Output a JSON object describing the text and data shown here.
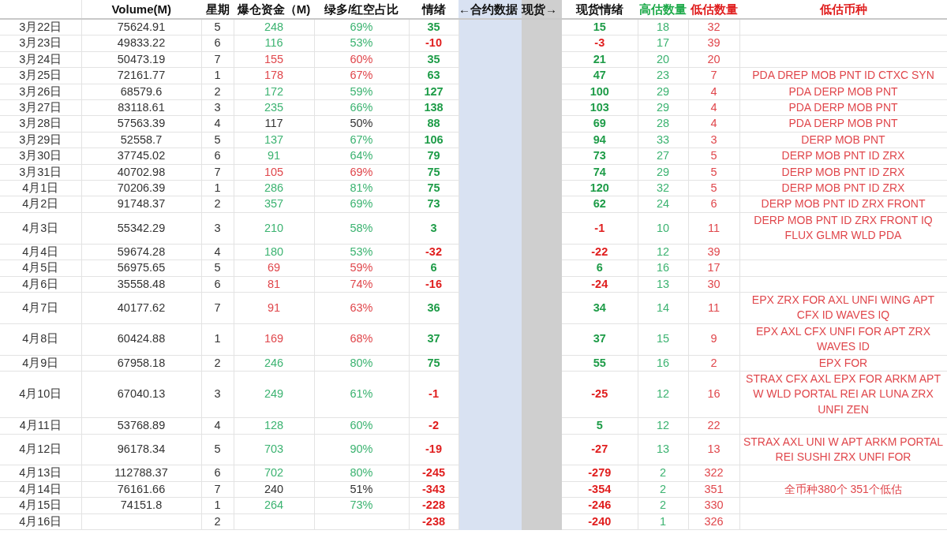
{
  "headers": [
    {
      "label": "Volume(M)"
    },
    {
      "label": "星期"
    },
    {
      "label": "爆仓资金（M)"
    },
    {
      "label": "绿多/红空占比"
    },
    {
      "label": "情绪"
    },
    {
      "label": "←合约数据"
    },
    {
      "label": "现货→"
    },
    {
      "label": "现货情绪"
    },
    {
      "label": "高估数量",
      "color": "#1eaa4a"
    },
    {
      "label": "低估数量",
      "color": "#e01e1e"
    },
    {
      "label": "低估币种",
      "color": "#e01e1e"
    }
  ],
  "rows": [
    {
      "date": "3月22日",
      "volume": "75624.91",
      "weekday": "5",
      "liquidation": {
        "text": "248",
        "color": "#3cb371"
      },
      "ratio": {
        "text": "69%",
        "color": "#3cb371"
      },
      "sentiment": {
        "text": "35",
        "color": "#1e9c48"
      },
      "spot": {
        "text": "15",
        "color": "#1e9c48"
      },
      "high": "18",
      "low": "32"
    },
    {
      "date": "3月23日",
      "volume": "49833.22",
      "weekday": "6",
      "liquidation": {
        "text": "116",
        "color": "#3cb371"
      },
      "ratio": {
        "text": "53%",
        "color": "#3cb371"
      },
      "sentiment": {
        "text": "-10",
        "color": "#e01e1e"
      },
      "spot": {
        "text": "-3",
        "color": "#e01e1e"
      },
      "high": "17",
      "low": "39"
    },
    {
      "date": "3月24日",
      "volume": "50473.19",
      "weekday": "7",
      "liquidation": {
        "text": "155",
        "color": "#e0474c"
      },
      "ratio": {
        "text": "60%",
        "color": "#e0474c"
      },
      "sentiment": {
        "text": "35",
        "color": "#1e9c48"
      },
      "spot": {
        "text": "21",
        "color": "#1e9c48"
      },
      "high": "20",
      "low": "20"
    },
    {
      "date": "3月25日",
      "volume": "72161.77",
      "weekday": "1",
      "liquidation": {
        "text": "178",
        "color": "#e0474c"
      },
      "ratio": {
        "text": "67%",
        "color": "#e0474c"
      },
      "sentiment": {
        "text": "63",
        "color": "#1e9c48"
      },
      "spot": {
        "text": "47",
        "color": "#1e9c48"
      },
      "high": "23",
      "low": "7",
      "coins": "PDA DREP MOB PNT ID CTXC SYN"
    },
    {
      "date": "3月26日",
      "volume": "68579.6",
      "weekday": "2",
      "liquidation": {
        "text": "172",
        "color": "#3cb371"
      },
      "ratio": {
        "text": "59%",
        "color": "#3cb371"
      },
      "sentiment": {
        "text": "127",
        "color": "#1e9c48"
      },
      "spot": {
        "text": "100",
        "color": "#1e9c48"
      },
      "high": "29",
      "low": "4",
      "coins": "PDA DERP MOB PNT"
    },
    {
      "date": "3月27日",
      "volume": "83118.61",
      "weekday": "3",
      "liquidation": {
        "text": "235",
        "color": "#3cb371"
      },
      "ratio": {
        "text": "66%",
        "color": "#3cb371"
      },
      "sentiment": {
        "text": "138",
        "color": "#1e9c48"
      },
      "spot": {
        "text": "103",
        "color": "#1e9c48"
      },
      "high": "29",
      "low": "4",
      "coins": "PDA DERP MOB PNT"
    },
    {
      "date": "3月28日",
      "volume": "57563.39",
      "weekday": "4",
      "liquidation": {
        "text": "117",
        "color": "#333333"
      },
      "ratio": {
        "text": "50%",
        "color": "#333333"
      },
      "sentiment": {
        "text": "88",
        "color": "#1e9c48"
      },
      "spot": {
        "text": "69",
        "color": "#1e9c48"
      },
      "high": "28",
      "low": "4",
      "coins": "PDA DERP MOB PNT"
    },
    {
      "date": "3月29日",
      "volume": "52558.7",
      "weekday": "5",
      "liquidation": {
        "text": "137",
        "color": "#3cb371"
      },
      "ratio": {
        "text": "67%",
        "color": "#3cb371"
      },
      "sentiment": {
        "text": "106",
        "color": "#1e9c48"
      },
      "spot": {
        "text": "94",
        "color": "#1e9c48"
      },
      "high": "33",
      "low": "3",
      "coins": "DERP MOB PNT"
    },
    {
      "date": "3月30日",
      "volume": "37745.02",
      "weekday": "6",
      "liquidation": {
        "text": "91",
        "color": "#3cb371"
      },
      "ratio": {
        "text": "64%",
        "color": "#3cb371"
      },
      "sentiment": {
        "text": "79",
        "color": "#1e9c48"
      },
      "spot": {
        "text": "73",
        "color": "#1e9c48"
      },
      "high": "27",
      "low": "5",
      "coins": "DERP MOB PNT ID ZRX"
    },
    {
      "date": "3月31日",
      "volume": "40702.98",
      "weekday": "7",
      "liquidation": {
        "text": "105",
        "color": "#e0474c"
      },
      "ratio": {
        "text": "69%",
        "color": "#e0474c"
      },
      "sentiment": {
        "text": "75",
        "color": "#1e9c48"
      },
      "spot": {
        "text": "74",
        "color": "#1e9c48"
      },
      "high": "29",
      "low": "5",
      "coins": "DERP MOB PNT ID ZRX"
    },
    {
      "date": "4月1日",
      "volume": "70206.39",
      "weekday": "1",
      "liquidation": {
        "text": "286",
        "color": "#3cb371"
      },
      "ratio": {
        "text": "81%",
        "color": "#3cb371"
      },
      "sentiment": {
        "text": "75",
        "color": "#1e9c48"
      },
      "spot": {
        "text": "120",
        "color": "#1e9c48"
      },
      "high": "32",
      "low": "5",
      "coins": "DERP MOB PNT ID ZRX"
    },
    {
      "date": "4月2日",
      "volume": "91748.37",
      "weekday": "2",
      "liquidation": {
        "text": "357",
        "color": "#3cb371"
      },
      "ratio": {
        "text": "69%",
        "color": "#3cb371"
      },
      "sentiment": {
        "text": "73",
        "color": "#1e9c48"
      },
      "spot": {
        "text": "62",
        "color": "#1e9c48"
      },
      "high": "24",
      "low": "6",
      "coins": "DERP MOB PNT ID ZRX FRONT"
    },
    {
      "date": "4月3日",
      "volume": "55342.29",
      "weekday": "3",
      "liquidation": {
        "text": "210",
        "color": "#3cb371"
      },
      "ratio": {
        "text": "58%",
        "color": "#3cb371"
      },
      "sentiment": {
        "text": "3",
        "color": "#1e9c48"
      },
      "spot": {
        "text": "-1",
        "color": "#e01e1e"
      },
      "high": "10",
      "low": "11",
      "coins": "DERP MOB PNT ID ZRX FRONT IQ FLUX GLMR WLD PDA"
    },
    {
      "date": "4月4日",
      "volume": "59674.28",
      "weekday": "4",
      "liquidation": {
        "text": "180",
        "color": "#3cb371"
      },
      "ratio": {
        "text": "53%",
        "color": "#3cb371"
      },
      "sentiment": {
        "text": "-32",
        "color": "#e01e1e"
      },
      "spot": {
        "text": "-22",
        "color": "#e01e1e"
      },
      "high": "12",
      "low": "39"
    },
    {
      "date": "4月5日",
      "volume": "56975.65",
      "weekday": "5",
      "liquidation": {
        "text": "69",
        "color": "#e0474c"
      },
      "ratio": {
        "text": "59%",
        "color": "#e0474c"
      },
      "sentiment": {
        "text": "6",
        "color": "#1e9c48"
      },
      "spot": {
        "text": "6",
        "color": "#1e9c48"
      },
      "high": "16",
      "low": "17"
    },
    {
      "date": "4月6日",
      "volume": "35558.48",
      "weekday": "6",
      "liquidation": {
        "text": "81",
        "color": "#e0474c"
      },
      "ratio": {
        "text": "74%",
        "color": "#e0474c"
      },
      "sentiment": {
        "text": "-16",
        "color": "#e01e1e"
      },
      "spot": {
        "text": "-24",
        "color": "#e01e1e"
      },
      "high": "13",
      "low": "30"
    },
    {
      "date": "4月7日",
      "volume": "40177.62",
      "weekday": "7",
      "liquidation": {
        "text": "91",
        "color": "#e0474c"
      },
      "ratio": {
        "text": "63%",
        "color": "#e0474c"
      },
      "sentiment": {
        "text": "36",
        "color": "#1e9c48"
      },
      "spot": {
        "text": "34",
        "color": "#1e9c48"
      },
      "high": "14",
      "low": "11",
      "coins": "EPX ZRX FOR AXL UNFI WING APT CFX ID WAVES IQ"
    },
    {
      "date": "4月8日",
      "volume": "60424.88",
      "weekday": "1",
      "liquidation": {
        "text": "169",
        "color": "#e0474c"
      },
      "ratio": {
        "text": "68%",
        "color": "#e0474c"
      },
      "sentiment": {
        "text": "37",
        "color": "#1e9c48"
      },
      "spot": {
        "text": "37",
        "color": "#1e9c48"
      },
      "high": "15",
      "low": "9",
      "coins": "EPX AXL CFX UNFI FOR APT ZRX WAVES ID"
    },
    {
      "date": "4月9日",
      "volume": "67958.18",
      "weekday": "2",
      "liquidation": {
        "text": "246",
        "color": "#3cb371"
      },
      "ratio": {
        "text": "80%",
        "color": "#3cb371"
      },
      "sentiment": {
        "text": "75",
        "color": "#1e9c48"
      },
      "spot": {
        "text": "55",
        "color": "#1e9c48"
      },
      "high": "16",
      "low": "2",
      "coins": "EPX FOR"
    },
    {
      "date": "4月10日",
      "volume": "67040.13",
      "weekday": "3",
      "liquidation": {
        "text": "249",
        "color": "#3cb371"
      },
      "ratio": {
        "text": "61%",
        "color": "#3cb371"
      },
      "sentiment": {
        "text": "-1",
        "color": "#e01e1e"
      },
      "spot": {
        "text": "-25",
        "color": "#e01e1e"
      },
      "high": "12",
      "low": "16",
      "coins": "STRAX CFX AXL EPX FOR ARKM APT W WLD PORTAL REI AR LUNA ZRX UNFI ZEN"
    },
    {
      "date": "4月11日",
      "volume": "53768.89",
      "weekday": "4",
      "liquidation": {
        "text": "128",
        "color": "#3cb371"
      },
      "ratio": {
        "text": "60%",
        "color": "#3cb371"
      },
      "sentiment": {
        "text": "-2",
        "color": "#e01e1e"
      },
      "spot": {
        "text": "5",
        "color": "#1e9c48"
      },
      "high": "12",
      "low": "22"
    },
    {
      "date": "4月12日",
      "volume": "96178.34",
      "weekday": "5",
      "liquidation": {
        "text": "703",
        "color": "#3cb371"
      },
      "ratio": {
        "text": "90%",
        "color": "#3cb371"
      },
      "sentiment": {
        "text": "-19",
        "color": "#e01e1e"
      },
      "spot": {
        "text": "-27",
        "color": "#e01e1e"
      },
      "high": "13",
      "low": "13",
      "coins": "STRAX AXL UNI W APT ARKM PORTAL REI SUSHI ZRX UNFI FOR"
    },
    {
      "date": "4月13日",
      "volume": "112788.37",
      "weekday": "6",
      "liquidation": {
        "text": "702",
        "color": "#3cb371"
      },
      "ratio": {
        "text": "80%",
        "color": "#3cb371"
      },
      "sentiment": {
        "text": "-245",
        "color": "#e01e1e"
      },
      "spot": {
        "text": "-279",
        "color": "#e01e1e"
      },
      "high": "2",
      "low": "322"
    },
    {
      "date": "4月14日",
      "volume": "76161.66",
      "weekday": "7",
      "liquidation": {
        "text": "240",
        "color": "#333333"
      },
      "ratio": {
        "text": "51%",
        "color": "#333333"
      },
      "sentiment": {
        "text": "-343",
        "color": "#e01e1e"
      },
      "spot": {
        "text": "-354",
        "color": "#e01e1e"
      },
      "high": "2",
      "low": "351",
      "coins": "全币种380个 351个低估"
    },
    {
      "date": "4月15日",
      "volume": "74151.8",
      "weekday": "1",
      "liquidation": {
        "text": "264",
        "color": "#3cb371"
      },
      "ratio": {
        "text": "73%",
        "color": "#3cb371"
      },
      "sentiment": {
        "text": "-228",
        "color": "#e01e1e"
      },
      "spot": {
        "text": "-246",
        "color": "#e01e1e"
      },
      "high": "2",
      "low": "330"
    },
    {
      "date": "4月16日",
      "weekday": "2",
      "sentiment": {
        "text": "-238",
        "color": "#e01e1e"
      },
      "spot": {
        "text": "-240",
        "color": "#e01e1e"
      },
      "high": "1",
      "low": "326"
    }
  ]
}
